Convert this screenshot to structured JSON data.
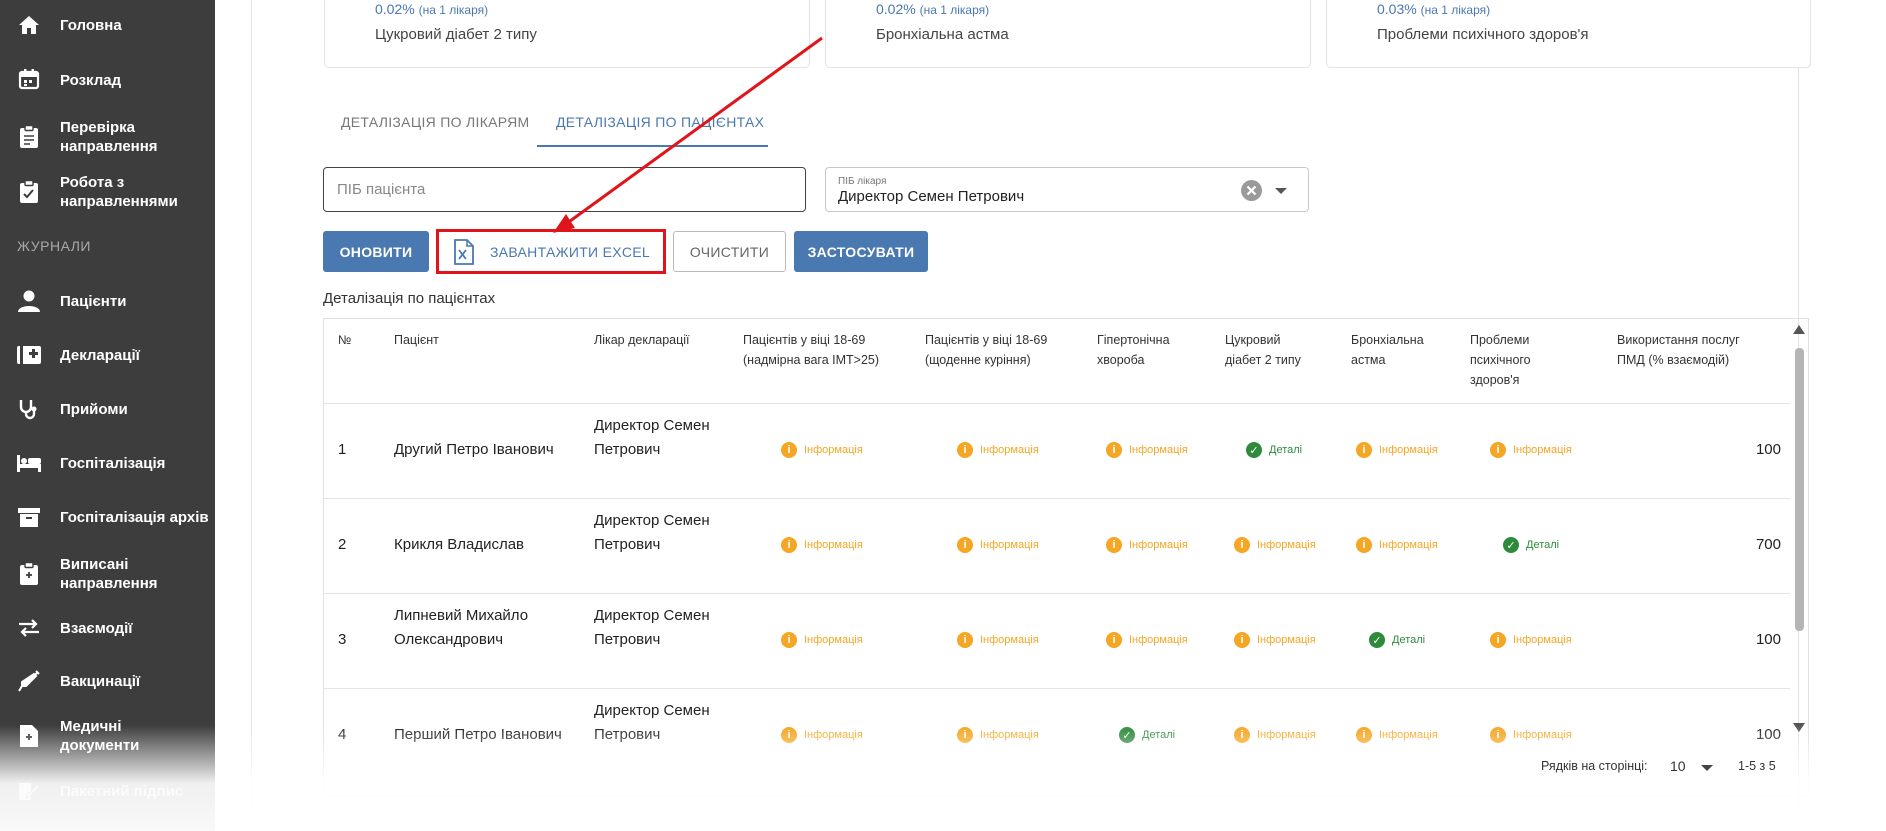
{
  "sidebar": {
    "items": [
      {
        "label": "Головна",
        "icon": "home-icon"
      },
      {
        "label": "Розклад",
        "icon": "calendar-icon"
      },
      {
        "label": "Перевірка\nнаправлення",
        "icon": "clipboard-check-icon"
      },
      {
        "label": "Робота з\nнаправленнями",
        "icon": "clipboard-list-icon"
      },
      {
        "label": "Пацієнти",
        "icon": "user-icon"
      },
      {
        "label": "Декларації",
        "icon": "medical-book-icon"
      },
      {
        "label": "Прийоми",
        "icon": "stethoscope-icon"
      },
      {
        "label": "Госпіталізація",
        "icon": "bed-icon"
      },
      {
        "label": "Госпіталізація архів",
        "icon": "archive-icon"
      },
      {
        "label": "Виписані\nнаправлення",
        "icon": "clipboard-document-icon"
      },
      {
        "label": "Взаємодії",
        "icon": "swap-arrows-icon"
      },
      {
        "label": "Вакцинації",
        "icon": "syringe-icon"
      },
      {
        "label": "Медичні\nдокументи",
        "icon": "medical-document-icon"
      },
      {
        "label": "Пакетний підпис",
        "icon": "signature-icon"
      }
    ],
    "section_label": "ЖУРНАЛИ"
  },
  "stats": [
    {
      "value": "0.02%",
      "note": "(на 1 лікаря)",
      "name": "Цукровий діабет 2 типу"
    },
    {
      "value": "0.02%",
      "note": "(на 1 лікаря)",
      "name": "Бронхіальна астма"
    },
    {
      "value": "0.03%",
      "note": "(на 1 лікаря)",
      "name": "Проблеми психічного здоров'я"
    }
  ],
  "tabs": [
    {
      "label": "Деталізація по лікарям"
    },
    {
      "label": "Деталізація по пацієнтах"
    }
  ],
  "filters": {
    "patient_placeholder": "ПІБ пацієнта",
    "doctor_label": "ПІБ лікаря",
    "doctor_value": "Директор Семен Петрович"
  },
  "buttons": {
    "refresh": "Оновити",
    "excel": "Завантажити Excel",
    "clear": "Очистити",
    "apply": "Застосувати"
  },
  "section_title": "Деталізація по пацієнтах",
  "table": {
    "headers": [
      "№",
      "Пацієнт",
      "Лікар декларації",
      "Пацієнтів у віці 18-69\n(надмірна вага ІМТ>25)",
      "Пацієнтів у віці 18-69\n(щоденне куріння)",
      "Гіпертонічна\nхвороба",
      "Цукровий\nдіабет 2 типу",
      "Бронхіальна\nастма",
      "Проблеми\nпсихічного\nздоров'я",
      "Використання послуг\nПМД (% взаємодій)"
    ],
    "rows": [
      {
        "num": "1",
        "patient": "Другий Петро Іванович",
        "doctor": "Директор Семен\nПетрович",
        "cells": [
          "Інформація",
          "Інформація",
          "Інформація",
          "Деталі",
          "Інформація",
          "Інформація"
        ],
        "pmd": "100"
      },
      {
        "num": "2",
        "patient": "Крикля Владислав",
        "doctor": "Директор Семен\nПетрович",
        "cells": [
          "Інформація",
          "Інформація",
          "Інформація",
          "Інформація",
          "Інформація",
          "Деталі"
        ],
        "pmd": "700"
      },
      {
        "num": "3",
        "patient": "Липневий Михайло\nОлександрович",
        "doctor": "Директор Семен\nПетрович",
        "cells": [
          "Інформація",
          "Інформація",
          "Інформація",
          "Інформація",
          "Деталі",
          "Інформація"
        ],
        "pmd": "100"
      },
      {
        "num": "4",
        "patient": "Перший Петро Іванович",
        "doctor": "Директор Семен\nПетрович",
        "cells": [
          "Інформація",
          "Інформація",
          "Деталі",
          "Інформація",
          "Інформація",
          "Інформація"
        ],
        "pmd": "100"
      }
    ]
  },
  "pagination": {
    "rows_label": "Рядків на сторінці:",
    "rows_value": "10",
    "range": "1-5 з 5"
  },
  "colors": {
    "sidebar_bg": "#3d3d3d",
    "accent": "#4a78b0",
    "info": "#f5a623",
    "ok": "#2e8b3c",
    "highlight": "#e0141b"
  }
}
